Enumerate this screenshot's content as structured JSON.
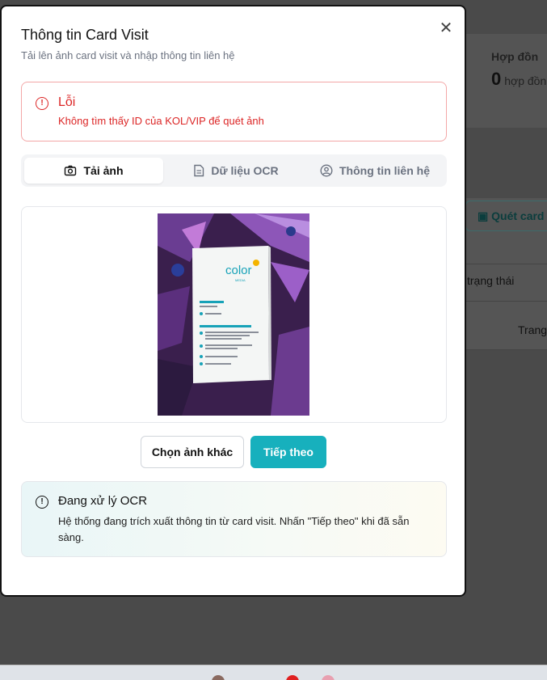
{
  "background": {
    "stats_title": "Hợp đồn",
    "stats_value": "0",
    "stats_unit": "hợp đồn",
    "scan_button": "Quét card",
    "status_text": "trạng thái",
    "column_text": "Trang"
  },
  "modal": {
    "title": "Thông tin Card Visit",
    "subtitle": "Tải lên ảnh card visit và nhập thông tin liên hệ",
    "close_icon": "close-icon"
  },
  "error": {
    "title": "Lỗi",
    "message": "Không tìm thấy ID của KOL/VIP để quét ảnh",
    "color": "#dc2626"
  },
  "tabs": [
    {
      "label": "Tải ảnh",
      "icon": "camera-icon",
      "active": true
    },
    {
      "label": "Dữ liệu OCR",
      "icon": "document-icon",
      "active": false
    },
    {
      "label": "Thông tin liên hệ",
      "icon": "user-circle-icon",
      "active": false
    }
  ],
  "card_photo": {
    "brand": "color",
    "brand_sub": "MEDIA"
  },
  "buttons": {
    "choose_other": "Chọn ảnh khác",
    "next": "Tiếp theo",
    "accent": "#17b0bd"
  },
  "ocr_notice": {
    "title": "Đang xử lý OCR",
    "message": "Hệ thống đang trích xuất thông tin từ card visit. Nhấn \"Tiếp theo\" khi đã sẵn sàng."
  }
}
